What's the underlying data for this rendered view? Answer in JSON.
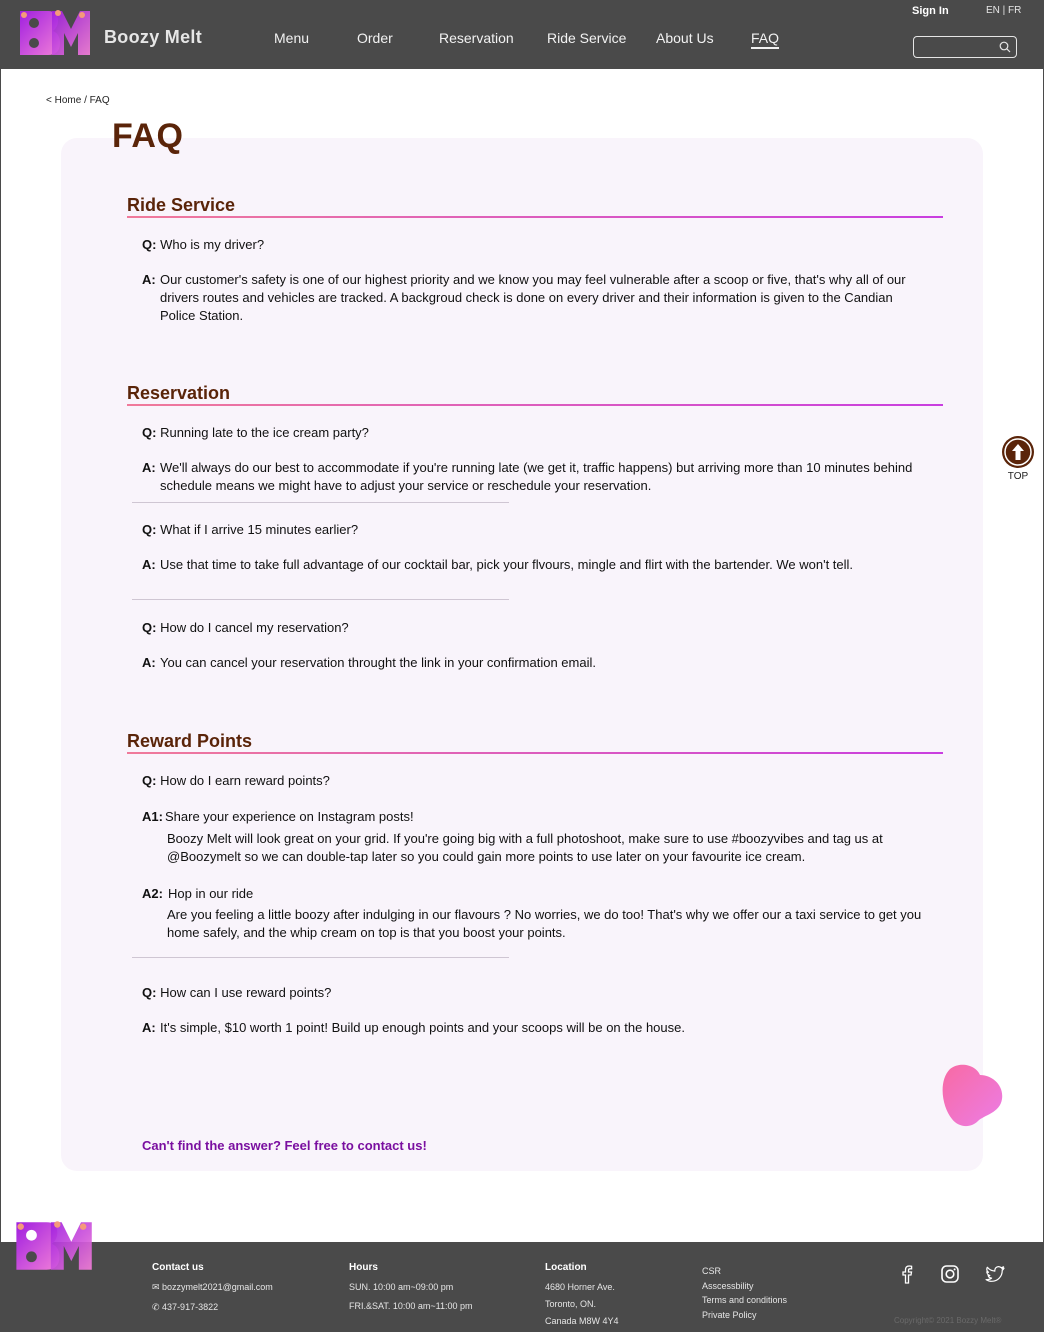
{
  "header": {
    "brand": "Boozy Melt",
    "nav": [
      "Menu",
      "Order",
      "Reservation",
      "Ride Service",
      "About Us",
      "FAQ"
    ],
    "active_nav": "FAQ",
    "sign_in": "Sign In",
    "language": "EN | FR",
    "search": {
      "value": "",
      "placeholder": ""
    },
    "colors": {
      "bar": "#4a4a4a",
      "logo_gradient": [
        "#a01fe0",
        "#f27fd8"
      ]
    }
  },
  "breadcrumb": "< Home / FAQ",
  "page_title": "FAQ",
  "sections": [
    {
      "title": "Ride Service",
      "items": [
        {
          "q_label": "Q:",
          "q": "Who is my driver?",
          "a_label": "A:",
          "a": "Our customer's safety is one of our highest priority and we know you may feel vulnerable after a scoop or five, that's why all of our drivers routes and vehicles are tracked. A backgroud check is done on every driver and their information is given to the Candian Police Station."
        }
      ]
    },
    {
      "title": "Reservation",
      "items": [
        {
          "q_label": "Q:",
          "q": "Running late to the ice cream party?",
          "a_label": "A:",
          "a": "We'll always do our best to accommodate if you're running late (we get it, traffic happens) but arriving more than 10 minutes behind schedule means we might  have to adjust your service or reschedule your reservation."
        },
        {
          "q_label": "Q:",
          "q": "What if I arrive 15 minutes earlier?",
          "a_label": "A:",
          "a": "Use that time to take full advantage of our cocktail bar, pick your flvours, mingle and flirt with the bartender. We won't tell."
        },
        {
          "q_label": "Q:",
          "q": "How do I cancel my reservation?",
          "a_label": "A:",
          "a": "You can cancel your reservation throught the link in your confirmation email."
        }
      ]
    },
    {
      "title": "Reward Points",
      "items": [
        {
          "q_label": "Q:",
          "q": "How do I earn reward points?",
          "answers": [
            {
              "label": "A1:",
              "title": "Share your experience on Instagram posts!",
              "text": "Boozy Melt  will look great on your grid. If you're going big with a full photoshoot, make sure to use #boozyvibes  and tag us at @Boozymelt so we can double-tap later so you could gain more points to use later on your favourite ice cream."
            },
            {
              "label": "A2:",
              "title": "Hop in our ride",
              "text": "Are you feeling a little boozy after indulging in our flavours ? No worries, we do too! That's why we offer our a taxi service to get you home safely, and the whip cream on top is that you boost your points."
            }
          ]
        },
        {
          "q_label": "Q:",
          "q": "How can I use reward points?",
          "a_label": "A:",
          "a": "It's simple, $10 worth 1 point! Build up enough points and your scoops will be on the house."
        }
      ]
    }
  ],
  "contact_cta": "Can't find the answer? Feel free to contact us!",
  "top_button": "TOP",
  "footer": {
    "contact": {
      "title": "Contact us",
      "email": "bozzymelt2021@gmail.com",
      "phone": "437-917-3822"
    },
    "hours": {
      "title": "Hours",
      "lines": [
        "SUN. 10:00 am~09:00 pm",
        "FRI.&SAT. 10:00 am~11:00 pm"
      ]
    },
    "location": {
      "title": "Location",
      "lines": [
        "4680 Horner Ave.",
        "Toronto, ON.",
        "Canada M8W 4Y4"
      ]
    },
    "links": [
      "CSR",
      "Asscessbility",
      "Terms and conditions",
      "Private Policy"
    ],
    "social_icons": [
      "facebook-icon",
      "instagram-icon",
      "twitter-icon"
    ],
    "copyright": "Copyright© 2021 Bozzy Melt®"
  },
  "colors": {
    "heading_brown": "#5a2409",
    "card_bg": "#f9f4fb",
    "cta_purple": "#7a0fa0",
    "rule_gradient": [
      "#f07a9a",
      "#c93ee0"
    ]
  }
}
